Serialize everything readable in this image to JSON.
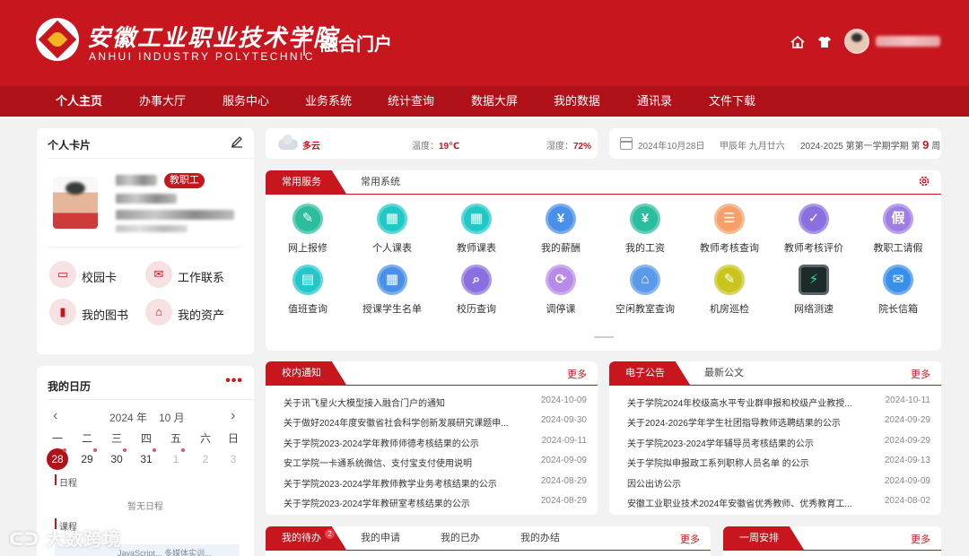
{
  "header": {
    "school_name_cn": "安徽工业职业技术学院",
    "school_name_en": "ANHUI INDUSTRY POLYTECHNIC",
    "portal_title": "融合门户",
    "icons": [
      "home-icon",
      "shirt-icon"
    ]
  },
  "nav": {
    "items": [
      "个人主页",
      "办事大厅",
      "服务中心",
      "业务系统",
      "统计查询",
      "数据大屏",
      "我的数据",
      "通讯录",
      "文件下载"
    ],
    "active": "个人主页"
  },
  "profile": {
    "title": "个人卡片",
    "role_tag": "教职工",
    "links": [
      "校园卡",
      "工作联系",
      "我的图书",
      "我的资产"
    ]
  },
  "calendar": {
    "title": "我的日历",
    "more": "•••",
    "year": "2024 年",
    "month": "10 月",
    "weekdays": [
      "一",
      "二",
      "三",
      "四",
      "五",
      "六",
      "日"
    ],
    "days": [
      "28",
      "29",
      "30",
      "31",
      "1",
      "2",
      "3"
    ],
    "today": "28",
    "schedule_label": "日程",
    "no_schedule": "暂无日程",
    "course_label": "课程",
    "course_preview": "JavaScript...          多媒体实训..."
  },
  "weather": {
    "condition": "多云",
    "temp_label": "温度：",
    "temp": "19℃",
    "humidity_label": "湿度：",
    "humidity": "72%"
  },
  "date_info": {
    "date": "2024年10月28日",
    "lunar": "甲辰年 九月廿六",
    "term": "2024-2025 第第一学期学期 第",
    "week_no": "9",
    "week_unit": "周"
  },
  "services": {
    "tabs": [
      "常用服务",
      "常用系统"
    ],
    "items": [
      {
        "label": "网上报修",
        "icon": "repair-icon",
        "color": "#2bbd9d",
        "glyph": "✎"
      },
      {
        "label": "个人课表",
        "icon": "timetable-icon",
        "color": "#22c8c8",
        "glyph": "▦"
      },
      {
        "label": "教师课表",
        "icon": "timetable-icon",
        "color": "#22c8c8",
        "glyph": "▦"
      },
      {
        "label": "我的薪酬",
        "icon": "salary-icon",
        "color": "#4a8fe8",
        "glyph": "¥"
      },
      {
        "label": "我的工资",
        "icon": "wage-icon",
        "color": "#2bbd9d",
        "glyph": "¥"
      },
      {
        "label": "教师考核查询",
        "icon": "assessment-icon",
        "color": "#f5a06a",
        "glyph": "☰"
      },
      {
        "label": "教师考核评价",
        "icon": "evaluation-icon",
        "color": "#8a6fe0",
        "glyph": "✓"
      },
      {
        "label": "教职工请假",
        "icon": "leave-icon",
        "color": "#a07de6",
        "glyph": "假"
      },
      {
        "label": "值班查询",
        "icon": "duty-icon",
        "color": "#22c8c8",
        "glyph": "▤"
      },
      {
        "label": "授课学生名单",
        "icon": "student-list-icon",
        "color": "#4a8fe8",
        "glyph": "▦"
      },
      {
        "label": "校历查询",
        "icon": "school-calendar-icon",
        "color": "#8a6fe0",
        "glyph": "⌕"
      },
      {
        "label": "调停课",
        "icon": "course-change-icon",
        "color": "#b98be8",
        "glyph": "⟳"
      },
      {
        "label": "空闲教室查询",
        "icon": "classroom-icon",
        "color": "#5a9ae8",
        "glyph": "⌂"
      },
      {
        "label": "机房巡检",
        "icon": "inspection-icon",
        "color": "#c9c41e",
        "glyph": "✎"
      },
      {
        "label": "网络测速",
        "icon": "speedtest-icon",
        "color": "#1c2a2a",
        "glyph": "⚡"
      },
      {
        "label": "院长信箱",
        "icon": "mailbox-icon",
        "color": "#3a8fe8",
        "glyph": "✉"
      }
    ]
  },
  "notices": {
    "tab": "校内通知",
    "more": "更多",
    "rows": [
      {
        "title": "关于讯飞星火大模型接入融合门户的通知",
        "date": "2024-10-09"
      },
      {
        "title": "关于做好2024年度安徽省社会科学创新发展研究课题申...",
        "date": "2024-09-30"
      },
      {
        "title": "关于学院2023-2024学年教师师德考核结果的公示",
        "date": "2024-09-11"
      },
      {
        "title": "安工学院一卡通系统微信、支付宝支付使用说明",
        "date": "2024-09-09"
      },
      {
        "title": "关于学院2023-2024学年教师教学业务考核结果的公示",
        "date": "2024-08-29"
      },
      {
        "title": "关于学院2023-2024学年教研室考核结果的公示",
        "date": "2024-08-29"
      }
    ]
  },
  "announcements": {
    "tabs": [
      "电子公告",
      "最新公文"
    ],
    "more": "更多",
    "rows": [
      {
        "title": "关于学院2024年校级高水平专业群申报和校级产业教授...",
        "date": "2024-10-11"
      },
      {
        "title": "关于2024-2026学年学生社团指导教师选聘结果的公示",
        "date": "2024-09-29"
      },
      {
        "title": "关于学院2023-2024学年辅导员考核结果的公示",
        "date": "2024-09-29"
      },
      {
        "title": "关于学院拟申报政工系列职称人员名单 的公示",
        "date": "2024-09-13"
      },
      {
        "title": "因公出访公示",
        "date": "2024-09-09"
      },
      {
        "title": "安徽工业职业技术2024年安徽省优秀教师、优秀教育工...",
        "date": "2024-08-02"
      }
    ]
  },
  "todo": {
    "tabs": [
      "我的待办",
      "我的申请",
      "我的已办",
      "我的办结"
    ],
    "badge": "2",
    "more": "更多"
  },
  "week": {
    "tab": "一周安排",
    "more": "更多"
  },
  "watermark": "大数跨境"
}
